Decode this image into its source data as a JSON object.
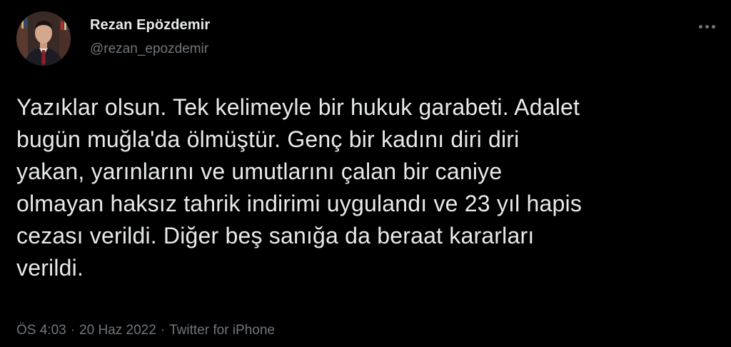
{
  "tweet": {
    "author": {
      "display_name": "Rezan Epözdemir",
      "handle": "@rezan_epozdemir"
    },
    "more_icon": "more-horizontal-icon",
    "text": "Yazıklar olsun. Tek kelimeyle bir hukuk garabeti. Adalet\nbugün muğla'da ölmüştür. Genç bir kadını diri diri\nyakan, yarınlarını ve umutlarını çalan bir caniye\nolmayan haksız tahrik indirimi uygulandı ve 23 yıl hapis\ncezası verildi. Diğer beş sanığa da beraat kararları\nverildi.",
    "time": "ÖS 4:03",
    "separator": "·",
    "date": "20 Haz 2022",
    "source": "Twitter for iPhone"
  },
  "colors": {
    "background": "#000000",
    "primary_text": "#e7e9ea",
    "secondary_text": "#71767b"
  }
}
